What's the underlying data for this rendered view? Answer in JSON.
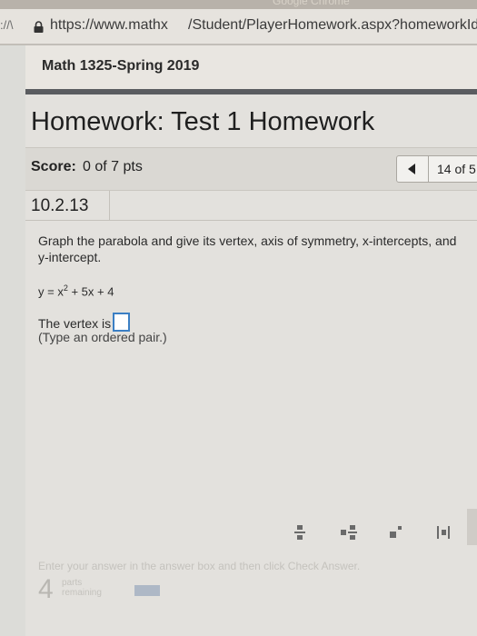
{
  "browser": {
    "tab_fragment": "Google Chrome",
    "back_fragment": "://\\",
    "url": "https://www.mathx     /Student/PlayerHomework.aspx?homeworkId"
  },
  "course": {
    "title": "Math 1325-Spring 2019"
  },
  "homework": {
    "title": "Homework: Test 1 Homework",
    "score_label": "Score:",
    "score_value": "0 of 7 pts",
    "question_position": "14 of 5",
    "question_number": "10.2.13"
  },
  "question": {
    "prompt": "Graph the parabola and give its vertex, axis of symmetry, x-intercepts, and y-intercept.",
    "equation_lhs": "y = x",
    "equation_exp": "2",
    "equation_rhs": " + 5x + 4",
    "vertex_label": "The vertex is",
    "hint": "(Type an ordered pair.)"
  },
  "toolbar": {
    "icons": [
      "fraction-icon",
      "mixed-number-icon",
      "exponent-icon",
      "absolute-value-icon"
    ]
  },
  "footer": {
    "instruction": "Enter your answer in the answer box and then click Check Answer.",
    "parts_count": "4",
    "parts_label": "parts remaining"
  },
  "colors": {
    "answer_border": "#3b7fc4",
    "header_divider": "#5a5c60"
  }
}
